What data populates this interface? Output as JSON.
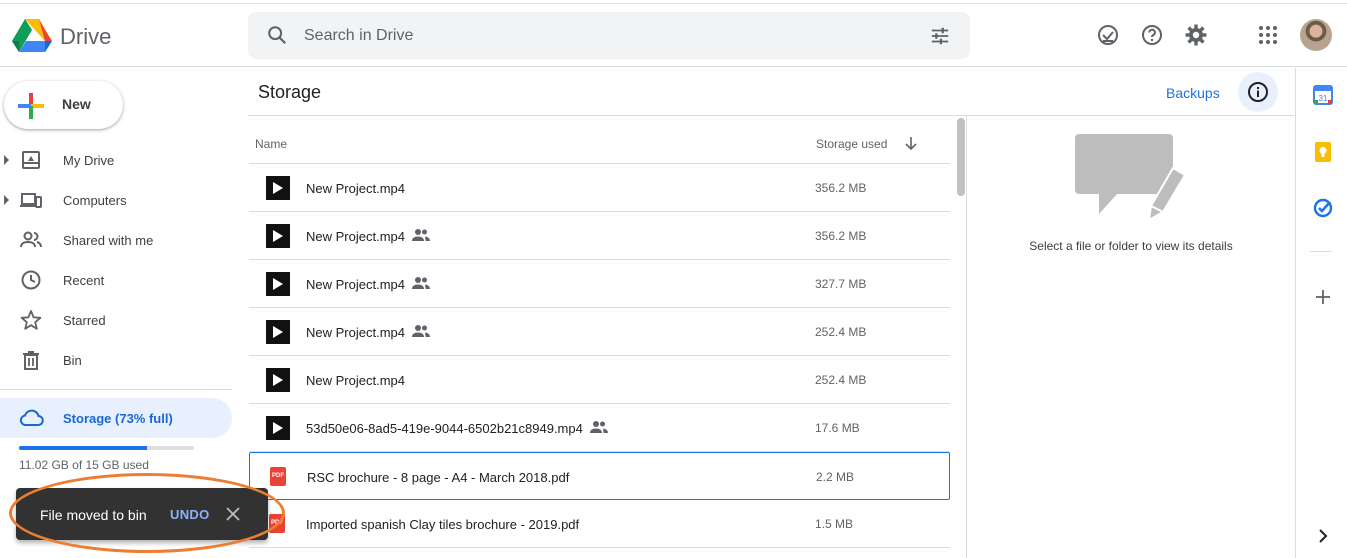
{
  "app": {
    "title": "Drive"
  },
  "search": {
    "placeholder": "Search in Drive"
  },
  "header_icons": [
    "ready-for-offline-icon",
    "help-icon",
    "settings-icon",
    "apps-grid-icon",
    "account-avatar"
  ],
  "new_button": {
    "label": "New"
  },
  "nav": {
    "items": [
      {
        "label": "My Drive",
        "icon": "my-drive-icon",
        "expandable": true
      },
      {
        "label": "Computers",
        "icon": "computers-icon",
        "expandable": true
      },
      {
        "label": "Shared with me",
        "icon": "shared-with-me-icon",
        "expandable": false
      },
      {
        "label": "Recent",
        "icon": "clock-icon",
        "expandable": false
      },
      {
        "label": "Starred",
        "icon": "star-icon",
        "expandable": false
      },
      {
        "label": "Bin",
        "icon": "trash-icon",
        "expandable": false
      }
    ],
    "storage": {
      "label": "Storage (73% full)",
      "used_fraction": 0.73,
      "usage_text": "11.02 GB of 15 GB used"
    }
  },
  "main": {
    "title": "Storage",
    "backups_label": "Backups",
    "columns": {
      "name": "Name",
      "storage_used": "Storage used"
    },
    "files": [
      {
        "name": "New Project.mp4",
        "size": "356.2 MB",
        "type": "video",
        "shared": false,
        "selected": false
      },
      {
        "name": "New Project.mp4",
        "size": "356.2 MB",
        "type": "video",
        "shared": true,
        "selected": false
      },
      {
        "name": "New Project.mp4",
        "size": "327.7 MB",
        "type": "video",
        "shared": true,
        "selected": false
      },
      {
        "name": "New Project.mp4",
        "size": "252.4 MB",
        "type": "video",
        "shared": true,
        "selected": false
      },
      {
        "name": "New Project.mp4",
        "size": "252.4 MB",
        "type": "video",
        "shared": false,
        "selected": false
      },
      {
        "name": "53d50e06-8ad5-419e-9044-6502b21c8949.mp4",
        "size": "17.6 MB",
        "type": "video",
        "shared": true,
        "selected": false
      },
      {
        "name": "RSC brochure - 8 page - A4 - March 2018.pdf",
        "size": "2.2 MB",
        "type": "pdf",
        "shared": false,
        "selected": true
      },
      {
        "name": "Imported spanish Clay tiles brochure - 2019.pdf",
        "size": "1.5 MB",
        "type": "pdf",
        "shared": false,
        "selected": false
      }
    ]
  },
  "details": {
    "message": "Select a file or folder to view its details"
  },
  "side_panel": {
    "apps": [
      "calendar-icon",
      "keep-icon",
      "tasks-icon",
      "add-icon",
      "chevron-right-icon"
    ]
  },
  "snackbar": {
    "text": "File moved to bin",
    "undo_label": "UNDO"
  },
  "colors": {
    "accent": "#1a73e8",
    "selected_nav_bg": "#e8f0fe",
    "snackbar_bg": "#323232",
    "highlight_ellipse": "#ed7d31"
  }
}
